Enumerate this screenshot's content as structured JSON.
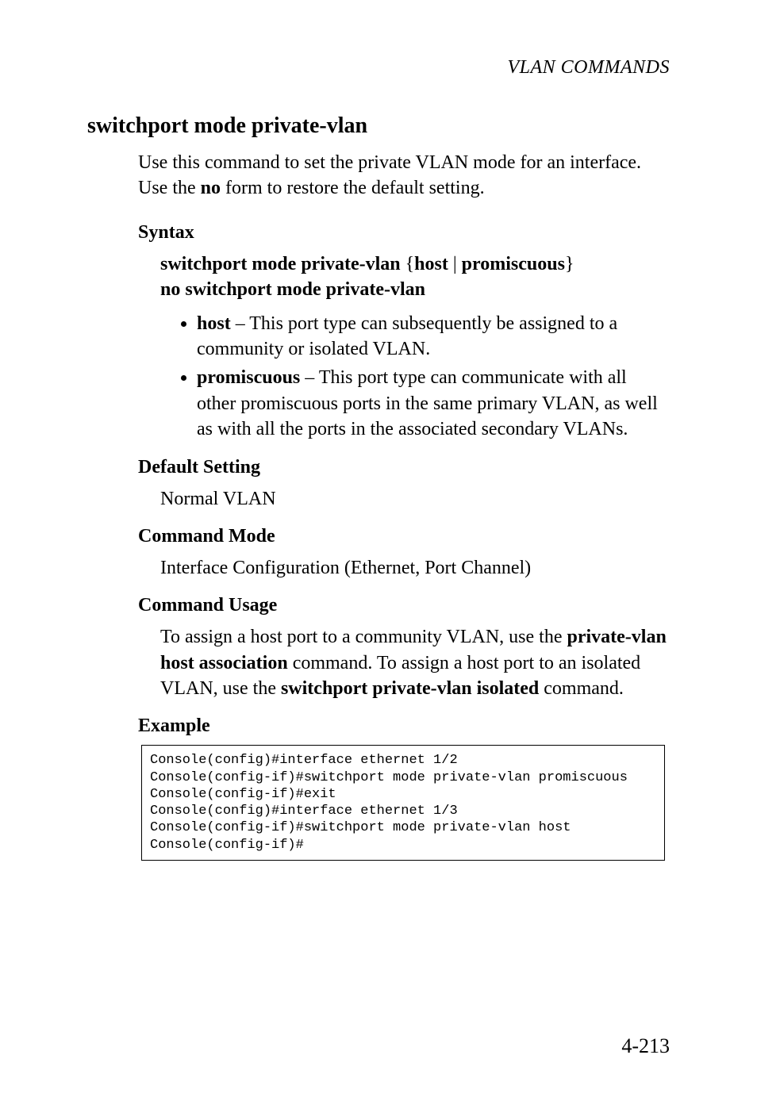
{
  "running_head": "VLAN COMMANDS",
  "command_title": "switchport mode private-vlan",
  "intro_before_no": "Use this command to set the private VLAN mode for an interface. Use the ",
  "intro_no": "no",
  "intro_after_no": " form to restore the default setting.",
  "syntax": {
    "label": "Syntax",
    "line1_b1": "switchport mode private-vlan",
    "line1_mid": " {",
    "line1_b2": "host",
    "line1_sep": " | ",
    "line1_b3": "promiscuous",
    "line1_end": "}",
    "line2_b": "no switchport mode private-vlan",
    "params": [
      {
        "kw": "host",
        "text": " – This port type can subsequently be assigned to a community or isolated VLAN."
      },
      {
        "kw": "promiscuous",
        "text": " – This port type can communicate with all other promiscuous ports in the same primary VLAN, as well as with all the ports in the associated secondary VLANs."
      }
    ]
  },
  "default_setting": {
    "label": "Default Setting",
    "text": "Normal VLAN"
  },
  "command_mode": {
    "label": "Command Mode",
    "text": "Interface Configuration (Ethernet, Port Channel)"
  },
  "command_usage": {
    "label": "Command Usage",
    "pre1": "To assign a host port to a community VLAN, use the ",
    "b1": "private-vlan host association",
    "mid1": " command. To assign a host port to an isolated VLAN, use the ",
    "b2": "switchport private-vlan isolated",
    "post": " command."
  },
  "example": {
    "label": "Example",
    "lines": "Console(config)#interface ethernet 1/2\nConsole(config-if)#switchport mode private-vlan promiscuous\nConsole(config-if)#exit\nConsole(config)#interface ethernet 1/3\nConsole(config-if)#switchport mode private-vlan host\nConsole(config-if)#"
  },
  "page_number": "4-213"
}
